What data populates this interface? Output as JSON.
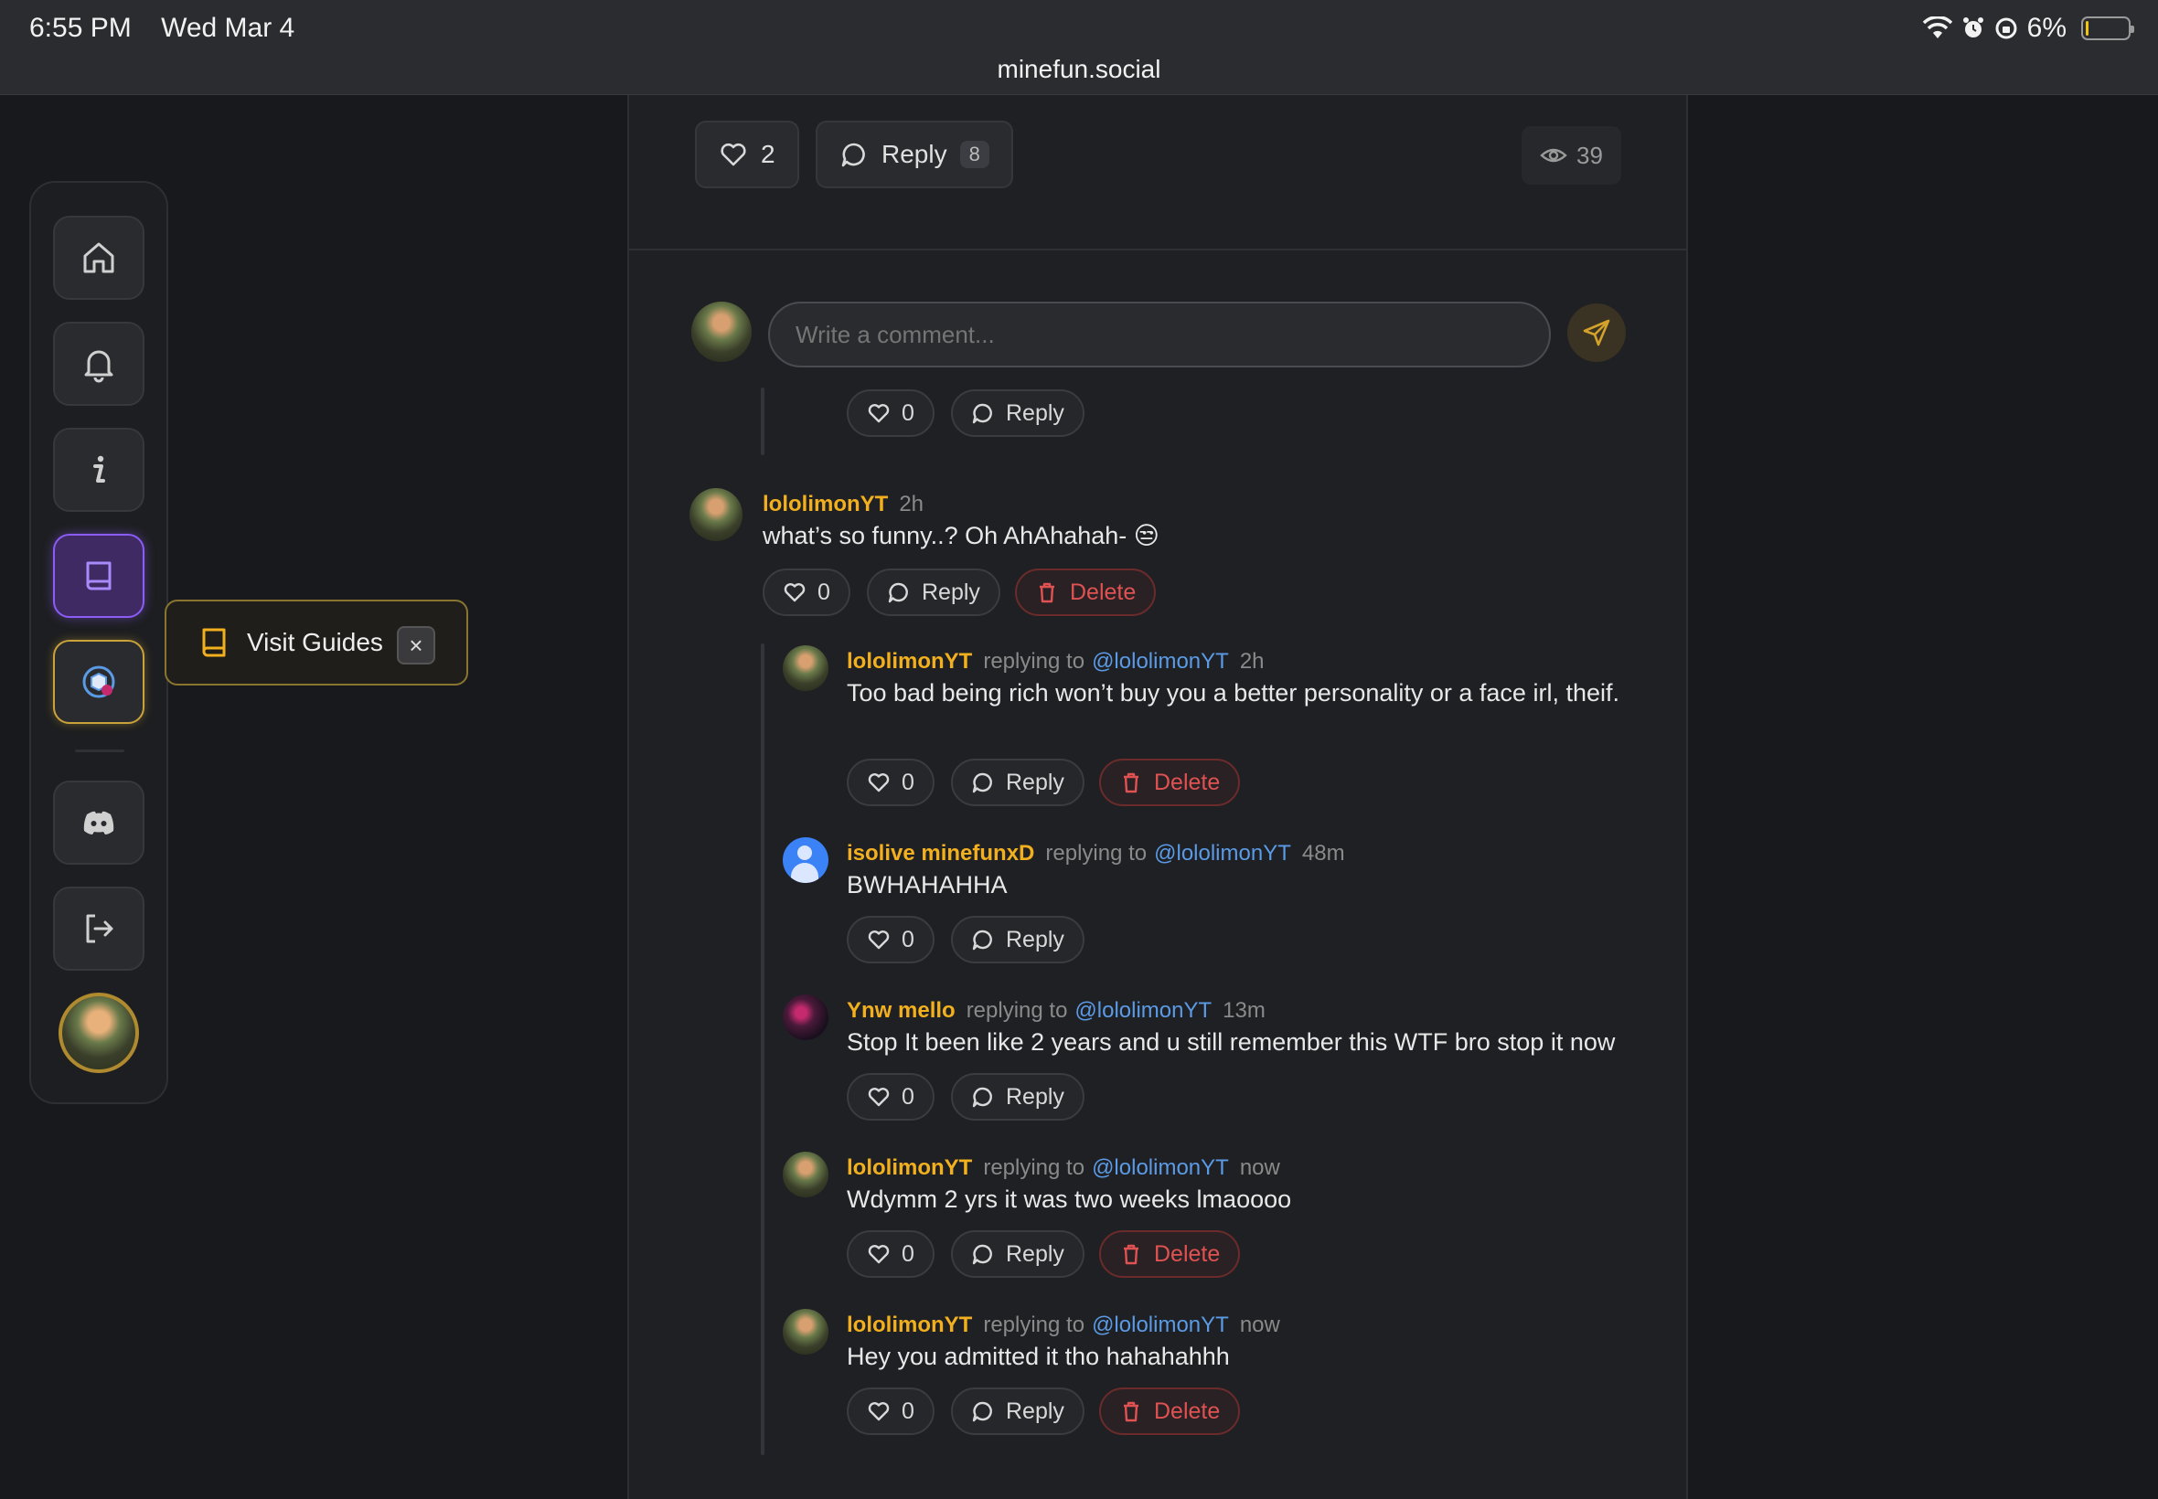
{
  "status_bar": {
    "time": "6:55 PM",
    "date": "Wed Mar 4",
    "url": "minefun.social",
    "battery": "6%",
    "battery_level": 0.06
  },
  "sidebar": {
    "items": [
      {
        "name": "home",
        "icon": "home-icon"
      },
      {
        "name": "notifications",
        "icon": "bell-icon"
      },
      {
        "name": "info",
        "icon": "info-icon"
      },
      {
        "name": "guides",
        "icon": "book-icon",
        "active": true
      },
      {
        "name": "app",
        "icon": "app-logo-icon"
      },
      {
        "name": "discord",
        "icon": "discord-icon"
      },
      {
        "name": "logout",
        "icon": "logout-icon"
      }
    ]
  },
  "tooltip": {
    "label": "Visit Guides",
    "close": "×"
  },
  "post": {
    "likes": "2",
    "reply_label": "Reply",
    "reply_count": "8",
    "views": "39"
  },
  "composer": {
    "placeholder": "Write a comment..."
  },
  "top_actions": {
    "likes": "0",
    "reply_label": "Reply"
  },
  "comment": {
    "user": "lololimonYT",
    "time": "2h",
    "text": "what’s so funny..? Oh AhAhahah- 😒",
    "likes": "0",
    "reply_label": "Reply",
    "delete_label": "Delete"
  },
  "replies": [
    {
      "user": "lololimonYT",
      "replying_prefix": "replying to",
      "mention": "@lololimonYT",
      "time": "2h",
      "text": "Too bad being rich won’t buy you a better personality or a face irl, theif.",
      "likes": "0",
      "reply_label": "Reply",
      "delete_label": "Delete"
    },
    {
      "user": "isolive minefunxD",
      "replying_prefix": "replying to",
      "mention": "@lololimonYT",
      "time": "48m",
      "text": "BWHAHAHHA",
      "likes": "0",
      "reply_label": "Reply"
    },
    {
      "user": "Ynw mello",
      "replying_prefix": "replying to",
      "mention": "@lololimonYT",
      "time": "13m",
      "text": "Stop It been like 2 years and u still remember this WTF bro stop it now",
      "likes": "0",
      "reply_label": "Reply"
    },
    {
      "user": "lololimonYT",
      "replying_prefix": "replying to",
      "mention": "@lololimonYT",
      "time": "now",
      "text": "Wdymm 2 yrs it was two weeks lmaoooo",
      "likes": "0",
      "reply_label": "Reply",
      "delete_label": "Delete"
    },
    {
      "user": "lololimonYT",
      "replying_prefix": "replying to",
      "mention": "@lololimonYT",
      "time": "now",
      "text": "Hey you admitted it tho hahahahhh",
      "likes": "0",
      "reply_label": "Reply",
      "delete_label": "Delete"
    }
  ],
  "colors": {
    "accent_gold": "#f2b01e",
    "accent_purple": "#8b5cf6",
    "mention_blue": "#5b9be6",
    "delete_red": "#e05252"
  }
}
